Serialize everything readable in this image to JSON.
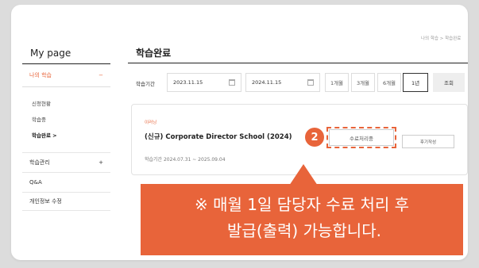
{
  "breadcrumb": "나의 학습 > 학습완료",
  "sidebar": {
    "title": "My page",
    "active_section": "나의 학습",
    "active_toggle": "−",
    "subitems": [
      "신청현황",
      "학습중",
      "학습완료 >"
    ],
    "sections": [
      {
        "label": "학습관리",
        "toggle": "+"
      },
      {
        "label": "Q&A",
        "toggle": ""
      },
      {
        "label": "개인정보 수정",
        "toggle": ""
      }
    ]
  },
  "main": {
    "title": "학습완료",
    "filter": {
      "label": "학습기간",
      "start_date": "2023.11.15",
      "end_date": "2024.11.15",
      "periods": [
        "1개월",
        "3개월",
        "6개월",
        "1년"
      ],
      "selected_period": "1년",
      "search_label": "조회"
    },
    "course": {
      "tag": "이러닝",
      "title": "(신규) Corporate Director School (2024)",
      "period": "학습기간 2024.07.31 ~ 2025.09.04",
      "complete_label": "수료처리중",
      "review_label": "후기작성"
    }
  },
  "annotation": {
    "step": "2",
    "line1": "※ 매월 1일 담당자 수료 처리 후",
    "line2": "발급(출력) 가능합니다.",
    "accent": "#e8643a"
  }
}
